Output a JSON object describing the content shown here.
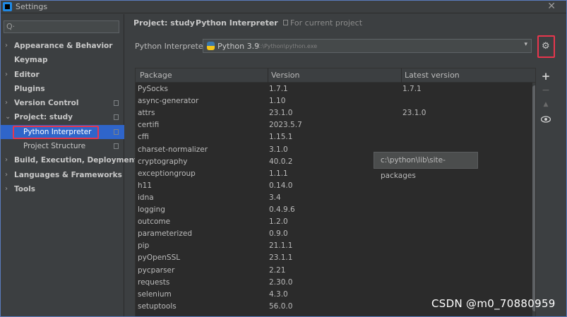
{
  "window": {
    "title": "Settings",
    "close_glyph": "✕"
  },
  "sidebar": {
    "search_glyph": "Q·",
    "items": [
      {
        "label": "Appearance & Behavior",
        "arrow": "›",
        "level": 0,
        "has_doc": false
      },
      {
        "label": "Keymap",
        "arrow": "",
        "level": 0,
        "has_doc": false
      },
      {
        "label": "Editor",
        "arrow": "›",
        "level": 0,
        "has_doc": false
      },
      {
        "label": "Plugins",
        "arrow": "",
        "level": 0,
        "has_doc": false
      },
      {
        "label": "Version Control",
        "arrow": "›",
        "level": 0,
        "has_doc": true
      },
      {
        "label": "Project: study",
        "arrow": "⌄",
        "level": 0,
        "has_doc": true
      },
      {
        "label": "Python Interpreter",
        "arrow": "",
        "level": 1,
        "has_doc": true,
        "selected": true
      },
      {
        "label": "Project Structure",
        "arrow": "",
        "level": 1,
        "has_doc": true
      },
      {
        "label": "Build, Execution, Deployment",
        "arrow": "›",
        "level": 0,
        "has_doc": false
      },
      {
        "label": "Languages & Frameworks",
        "arrow": "›",
        "level": 0,
        "has_doc": false
      },
      {
        "label": "Tools",
        "arrow": "›",
        "level": 0,
        "has_doc": false
      }
    ]
  },
  "breadcrumb": {
    "project": "Project: study",
    "separator": "›",
    "page": "Python Interpreter",
    "scope": "For current project"
  },
  "interpreter": {
    "label": "Python Interpreter:",
    "name": "Python 3.9",
    "path": "C:\\Python\\python.exe",
    "dropdown_glyph": "▾",
    "settings_glyph": "⚙"
  },
  "packages": {
    "columns": [
      "Package",
      "Version",
      "Latest version"
    ],
    "rows": [
      [
        "PySocks",
        "1.7.1",
        "1.7.1"
      ],
      [
        "async-generator",
        "1.10",
        ""
      ],
      [
        "attrs",
        "23.1.0",
        "23.1.0"
      ],
      [
        "certifi",
        "2023.5.7",
        ""
      ],
      [
        "cffi",
        "1.15.1",
        ""
      ],
      [
        "charset-normalizer",
        "3.1.0",
        ""
      ],
      [
        "cryptography",
        "40.0.2",
        ""
      ],
      [
        "exceptiongroup",
        "1.1.1",
        ""
      ],
      [
        "h11",
        "0.14.0",
        ""
      ],
      [
        "idna",
        "3.4",
        ""
      ],
      [
        "logging",
        "0.4.9.6",
        ""
      ],
      [
        "outcome",
        "1.2.0",
        ""
      ],
      [
        "parameterized",
        "0.9.0",
        ""
      ],
      [
        "pip",
        "21.1.1",
        ""
      ],
      [
        "pyOpenSSL",
        "23.1.1",
        ""
      ],
      [
        "pycparser",
        "2.21",
        ""
      ],
      [
        "requests",
        "2.30.0",
        ""
      ],
      [
        "selenium",
        "4.3.0",
        ""
      ],
      [
        "setuptools",
        "56.0.0",
        ""
      ]
    ]
  },
  "tooltip": {
    "text": "c:\\python\\lib\\site-packages"
  },
  "toolbar": {
    "add": "+",
    "remove": "−",
    "upgrade": "▲",
    "show": "👁"
  },
  "watermark": {
    "text": "CSDN @m0_70880959"
  },
  "colors": {
    "selection": "#2f65ca",
    "highlight_box": "#e8364d",
    "background": "#3c3f41",
    "table_bg": "#2b2b2b"
  }
}
